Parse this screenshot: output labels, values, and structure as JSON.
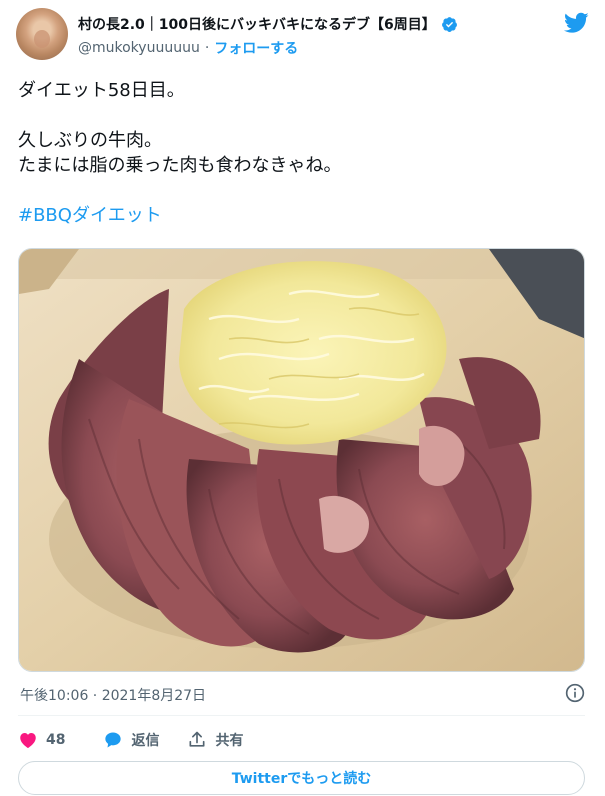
{
  "author": {
    "display_name": "村の長2.0｜100日後にバッキバキになるデブ【6周目】",
    "handle": "@mukokyuuuuuu",
    "separator": "·",
    "follow_label": "フォローする"
  },
  "tweet": {
    "lines": [
      "ダイエット58日目。",
      "久しぶりの牛肉。",
      "たまには脂の乗った肉も食わなきゃね。"
    ],
    "hashtag": "#BBQダイエット"
  },
  "meta": {
    "timestamp": "午後10:06 · 2021年8月27日"
  },
  "actions": {
    "likes": "48",
    "reply_label": "返信",
    "share_label": "共有"
  },
  "read_more_label": "Twitterでもっと読む",
  "colors": {
    "accent": "#1d9bf0",
    "like": "#f91880",
    "text": "#0f1419",
    "muted": "#536471"
  }
}
